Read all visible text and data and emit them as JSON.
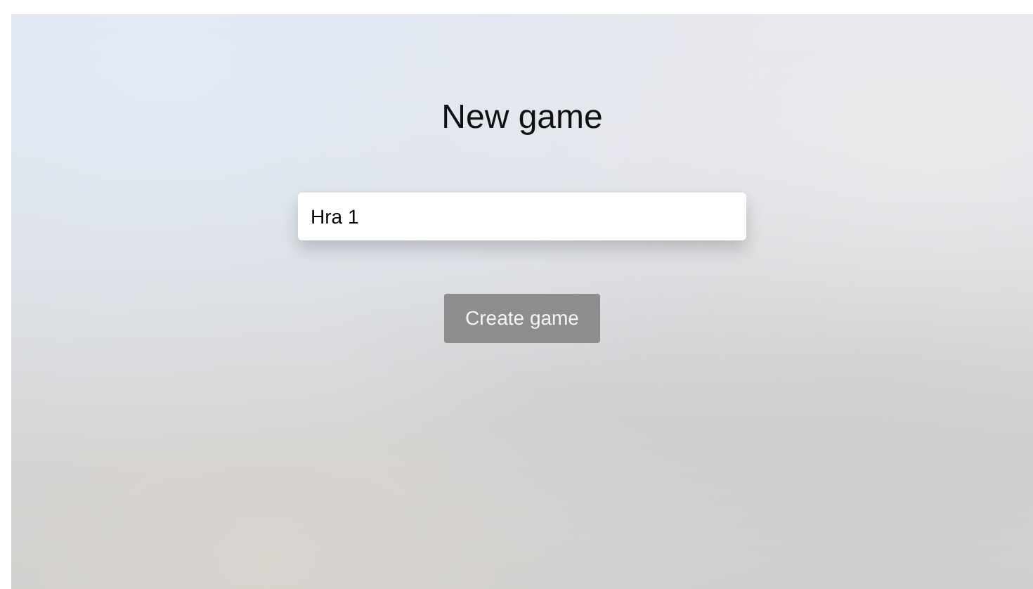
{
  "title": "New game",
  "name_field": {
    "value": "Hra 1"
  },
  "create_button": {
    "label": "Create game"
  }
}
